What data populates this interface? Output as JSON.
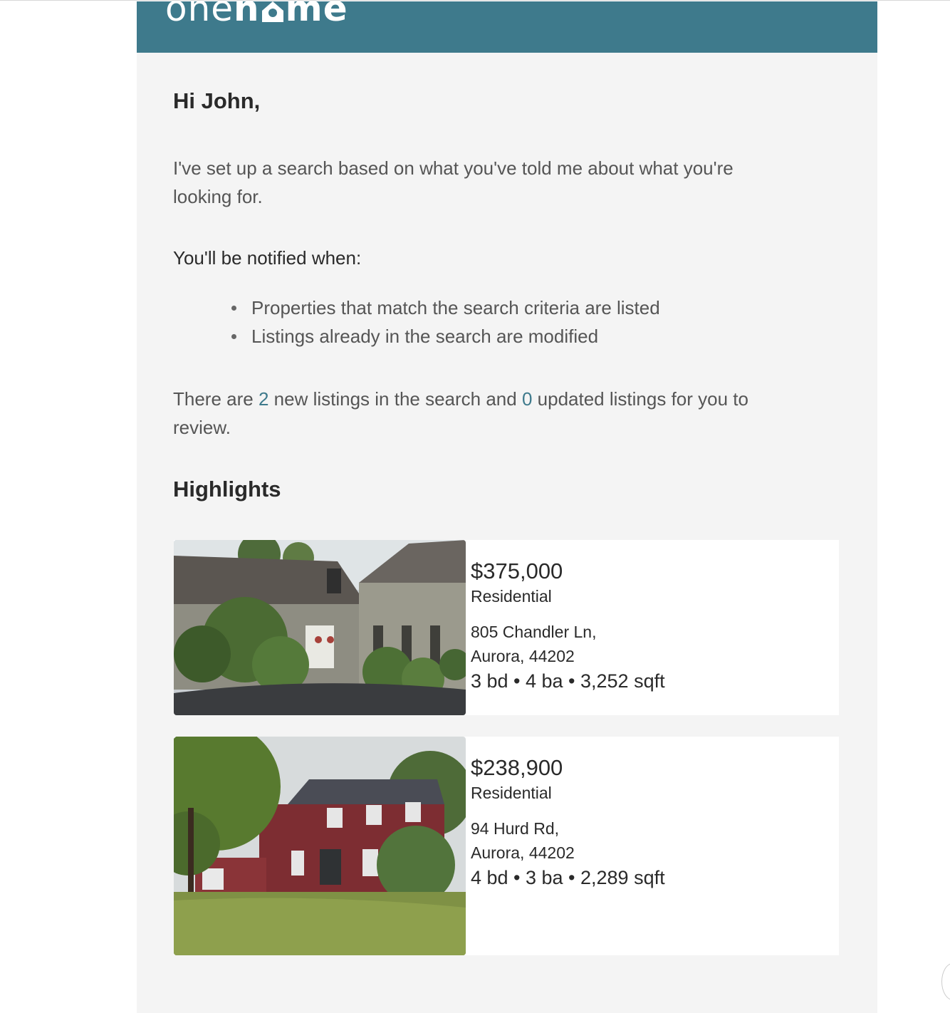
{
  "brand": {
    "logo_left": "one",
    "logo_right": "me",
    "colors": {
      "header": "#3e7a8c",
      "link": "#3e7a8c",
      "background": "#f4f4f4"
    }
  },
  "message": {
    "greeting": "Hi John,",
    "intro_line1": "I've set up a search based on what you've told me about what you're",
    "intro_line2": "looking for.",
    "notify_heading": "You'll be notified when:",
    "bullets": [
      "Properties that match the search criteria are listed",
      "Listings already in the search are modified"
    ],
    "summary_part1": "There are ",
    "new_count": "2",
    "summary_part2": " new listings in the search and ",
    "updated_count": "0",
    "summary_part3": " updated listings for you to",
    "summary_line2": "review."
  },
  "highlights": {
    "title": "Highlights",
    "listings": [
      {
        "price": "$375,000",
        "type": "Residential",
        "street": "805 Chandler Ln,",
        "city": "Aurora, 44202",
        "stats": "3 bd • 4 ba • 3,252 sqft",
        "photo_icon": "house-photo-gray"
      },
      {
        "price": "$238,900",
        "type": "Residential",
        "street": "94 Hurd Rd,",
        "city": "Aurora, 44202",
        "stats": "4 bd • 3 ba • 2,289 sqft",
        "photo_icon": "house-photo-red"
      }
    ]
  }
}
